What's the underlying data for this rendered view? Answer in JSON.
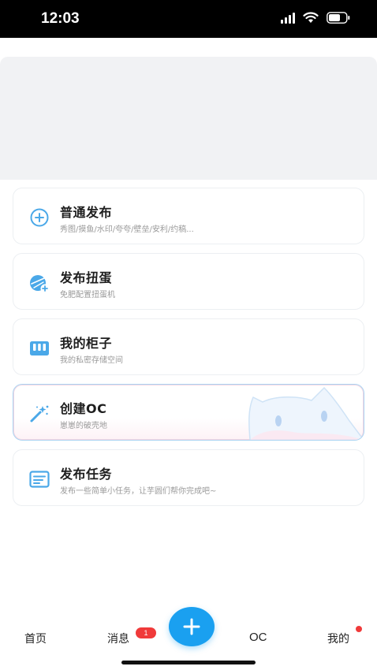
{
  "status_bar": {
    "time": "12:03"
  },
  "menu": [
    {
      "title": "普通发布",
      "subtitle": "秀图/摸鱼/水印/夸夸/壁垒/安利/约稿...",
      "icon": "plus-circle-icon"
    },
    {
      "title": "发布扭蛋",
      "subtitle": "免肥配置扭蛋机",
      "icon": "gashapon-icon"
    },
    {
      "title": "我的柜子",
      "subtitle": "我的私密存储空间",
      "icon": "cabinet-icon"
    },
    {
      "title": "创建OC",
      "subtitle": "崽崽的破壳地",
      "icon": "magic-wand-icon"
    },
    {
      "title": "发布任务",
      "subtitle": "发布一些简单小任务，让芋圆们帮你完成吧~",
      "icon": "task-list-icon"
    }
  ],
  "tab_bar": {
    "home": "首页",
    "messages": "消息",
    "messages_badge": "1",
    "oc": "OC",
    "mine": "我的"
  },
  "colors": {
    "accent": "#1aa0f0",
    "icon_blue": "#4aa8e8",
    "badge_red": "#f03a3a"
  }
}
